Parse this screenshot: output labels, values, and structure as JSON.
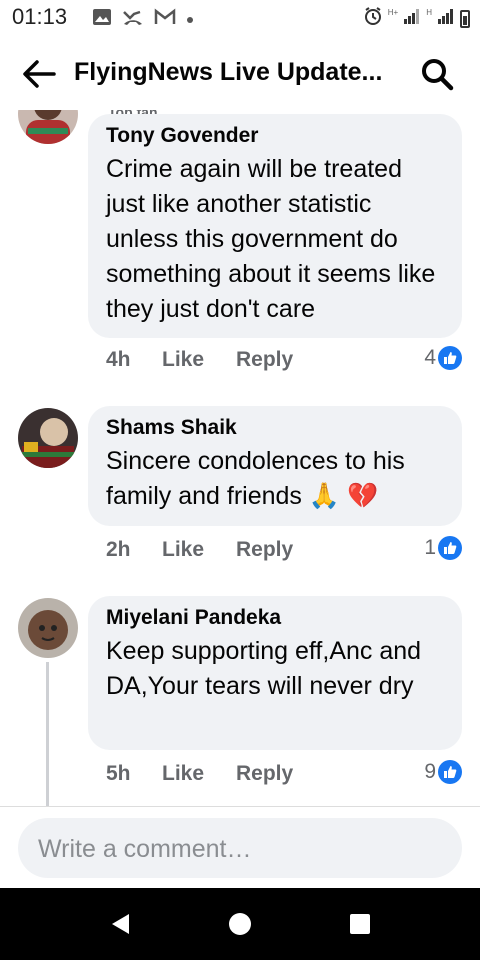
{
  "status_bar": {
    "time": "01:13",
    "left_icons": [
      "gallery-icon",
      "missed-call-icon",
      "gmail-icon",
      "notification-dot-icon"
    ],
    "network_label_1": "H+",
    "network_label_2": "H",
    "right_icons": [
      "alarm-icon",
      "signal-icon",
      "signal-icon",
      "battery-icon"
    ]
  },
  "header": {
    "title": "FlyingNews Live Update...",
    "back_icon": "arrow-left-icon",
    "search_icon": "search-icon"
  },
  "comments": [
    {
      "badge": "Top fan",
      "name": "Tony Govender",
      "text": "Crime again will be treated just like another statistic unless this government do something about it seems like they just don't care",
      "time": "4h",
      "like_label": "Like",
      "reply_label": "Reply",
      "reactions": "4"
    },
    {
      "name": "Shams Shaik",
      "text": "Sincere condolences to his family and friends 🙏 💔",
      "time": "2h",
      "like_label": "Like",
      "reply_label": "Reply",
      "reactions": "1"
    },
    {
      "name": "Miyelani Pandeka",
      "text": "Keep supporting eff,Anc and DA,Your tears will never dry",
      "time": "5h",
      "like_label": "Like",
      "reply_label": "Reply",
      "reactions": "9"
    }
  ],
  "composer": {
    "placeholder": "Write a comment…"
  },
  "colors": {
    "accent": "#1877f2",
    "bubble": "#f0f2f5",
    "muted_text": "#65676b"
  }
}
